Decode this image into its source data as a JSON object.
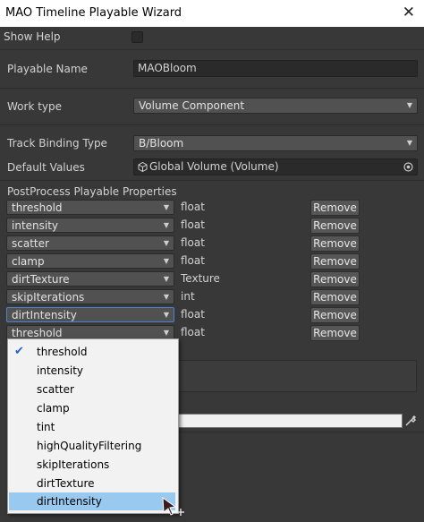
{
  "window": {
    "title": "MAO Timeline Playable Wizard",
    "close_glyph": "✕"
  },
  "show_help": {
    "label": "Show Help",
    "checked": false
  },
  "playable_name": {
    "label": "Playable Name",
    "value": "MAOBloom"
  },
  "work_type": {
    "label": "Work type",
    "value": "Volume Component"
  },
  "track_binding": {
    "label": "Track Binding Type",
    "value": "B/Bloom"
  },
  "default_values": {
    "label": "Default Values",
    "value": "Global Volume (Volume)",
    "icon": "cube-icon",
    "picker_icon": "object-picker-icon"
  },
  "postprocess": {
    "header": "PostProcess Playable Properties",
    "remove_label": "Remove",
    "rows": [
      {
        "property": "threshold",
        "type": "float"
      },
      {
        "property": "intensity",
        "type": "float"
      },
      {
        "property": "scatter",
        "type": "float"
      },
      {
        "property": "clamp",
        "type": "float"
      },
      {
        "property": "dirtTexture",
        "type": "Texture"
      },
      {
        "property": "skipIterations",
        "type": "int"
      },
      {
        "property": "dirtIntensity",
        "type": "float"
      },
      {
        "property": "threshold",
        "type": "float"
      }
    ]
  },
  "dropdown_menu": {
    "items": [
      "threshold",
      "intensity",
      "scatter",
      "clamp",
      "tint",
      "highQualityFiltering",
      "skipIterations",
      "dirtTexture",
      "dirtIntensity"
    ],
    "checked_item": "threshold",
    "hovered_item": "dirtIntensity"
  },
  "colors": {
    "background": "#383838",
    "field": "#2a2a2a",
    "popup": "#515151",
    "button": "#565656",
    "menu_bg": "#f2f2f2",
    "menu_hover": "#99c9ef",
    "focus": "#4b82d4",
    "check": "#2862c4"
  }
}
